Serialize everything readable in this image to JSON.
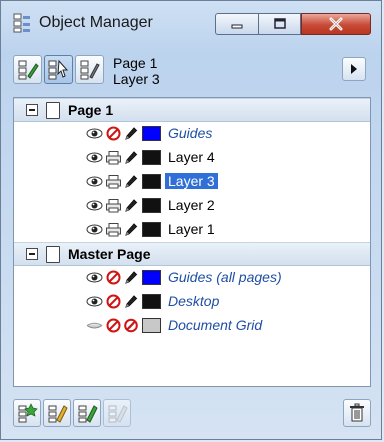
{
  "window": {
    "title": "Object Manager",
    "icon": "object-manager-icon"
  },
  "toolbar": {
    "buttons": [
      {
        "name": "show-object-properties",
        "icon": "object-properties-icon"
      },
      {
        "name": "edit-across-layers",
        "icon": "edit-across-layers-icon",
        "active": true
      },
      {
        "name": "layer-manager-view",
        "icon": "layer-manager-icon"
      }
    ],
    "current_page": "Page 1",
    "current_layer": "Layer 3",
    "flyout_icon": "triangle-right-icon"
  },
  "tree": {
    "groups": [
      {
        "label": "Page 1",
        "expander": "⊟",
        "layers": [
          {
            "name": "Guides",
            "style": "italic",
            "color": "#0000ff",
            "printable": false,
            "editable": true,
            "visible": true,
            "selected": false
          },
          {
            "name": "Layer 4",
            "style": "plain",
            "color": "#111111",
            "printable": true,
            "editable": true,
            "visible": true,
            "selected": false
          },
          {
            "name": "Layer 3",
            "style": "plain",
            "color": "#111111",
            "printable": true,
            "editable": true,
            "visible": true,
            "selected": true
          },
          {
            "name": "Layer 2",
            "style": "plain",
            "color": "#111111",
            "printable": true,
            "editable": true,
            "visible": true,
            "selected": false
          },
          {
            "name": "Layer 1",
            "style": "plain",
            "color": "#111111",
            "printable": true,
            "editable": true,
            "visible": true,
            "selected": false
          }
        ]
      },
      {
        "label": "Master Page",
        "expander": "⊟",
        "layers": [
          {
            "name": "Guides (all pages)",
            "style": "italic",
            "color": "#0000ff",
            "printable": false,
            "editable": true,
            "visible": true,
            "selected": false
          },
          {
            "name": "Desktop",
            "style": "italic",
            "color": "#111111",
            "printable": false,
            "editable": true,
            "visible": true,
            "selected": false
          },
          {
            "name": "Document Grid",
            "style": "italic",
            "color": "#c8c8c8",
            "printable": false,
            "editable": false,
            "visible": false,
            "selected": false
          }
        ]
      }
    ]
  },
  "bottom_bar": {
    "buttons": [
      {
        "name": "new-layer",
        "icon": "new-layer-icon"
      },
      {
        "name": "new-master-layer",
        "icon": "new-master-layer-icon"
      },
      {
        "name": "new-master-layer-odd",
        "icon": "new-master-layer-odd-icon"
      },
      {
        "name": "new-master-layer-even",
        "icon": "new-master-layer-even-icon",
        "disabled": true
      }
    ],
    "delete_icon": "trash-icon"
  },
  "colors": {
    "selection": "#2f6fd6",
    "guide_text": "#1e4fa3",
    "close_button": "#c94a38"
  }
}
